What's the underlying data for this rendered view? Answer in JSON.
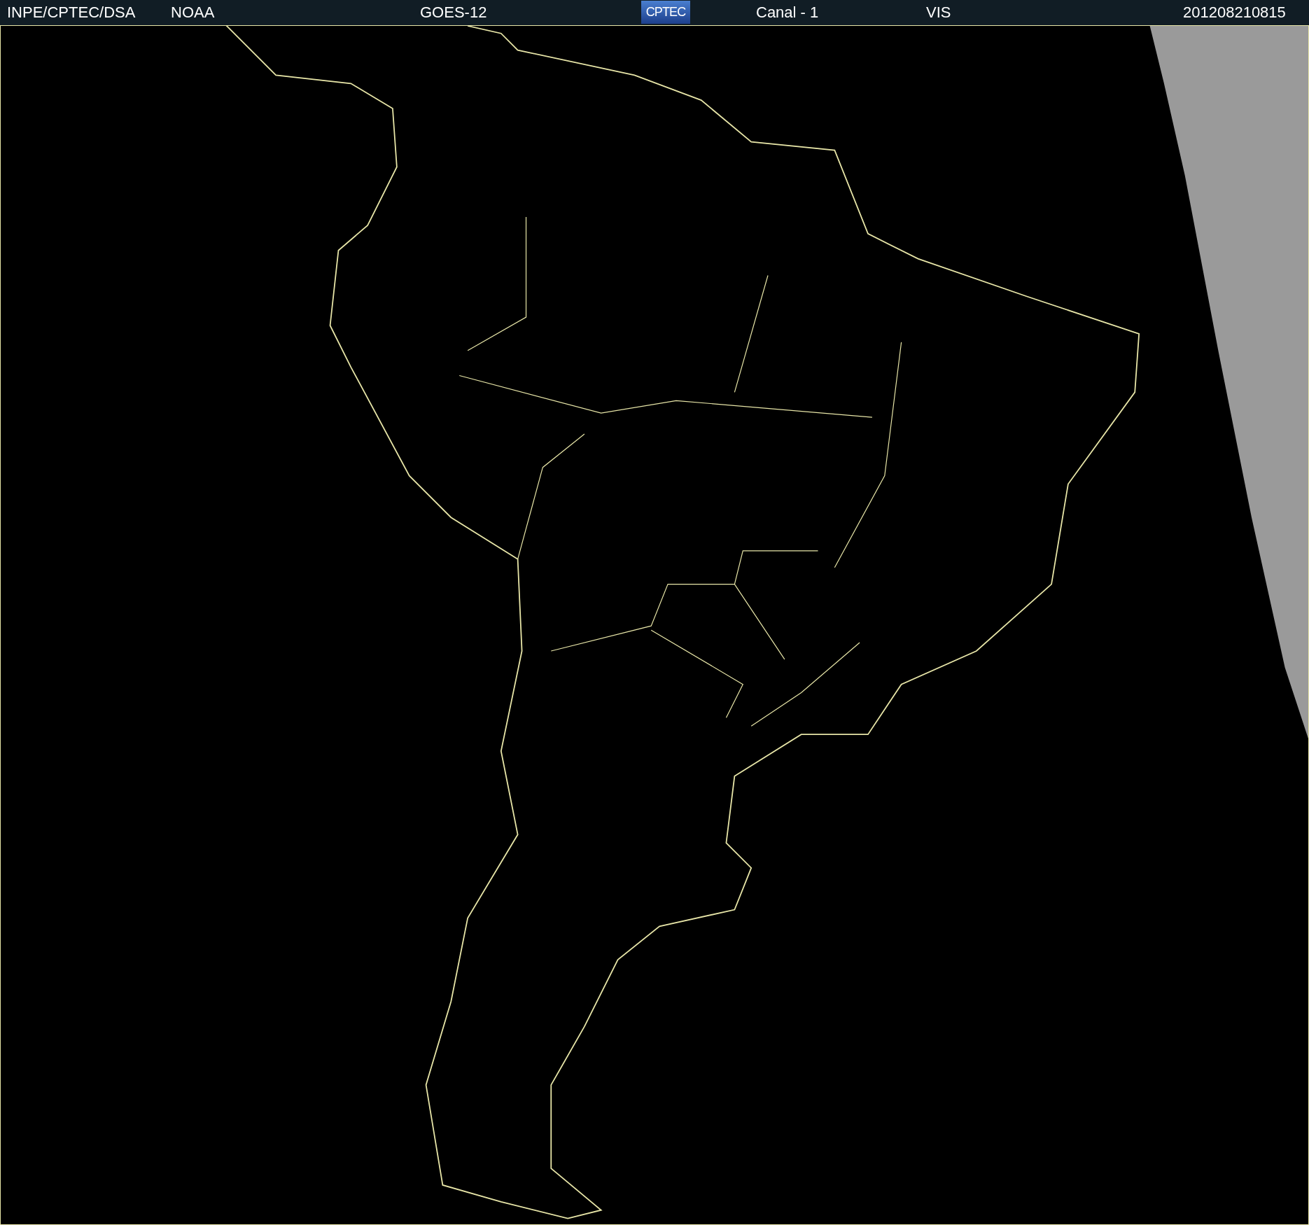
{
  "header": {
    "source": "INPE/CPTEC/DSA",
    "agency": "NOAA",
    "satellite": "GOES-12",
    "logo": "CPTEC",
    "channel": "Canal - 1",
    "band": "VIS",
    "timestamp": "201208210815"
  }
}
